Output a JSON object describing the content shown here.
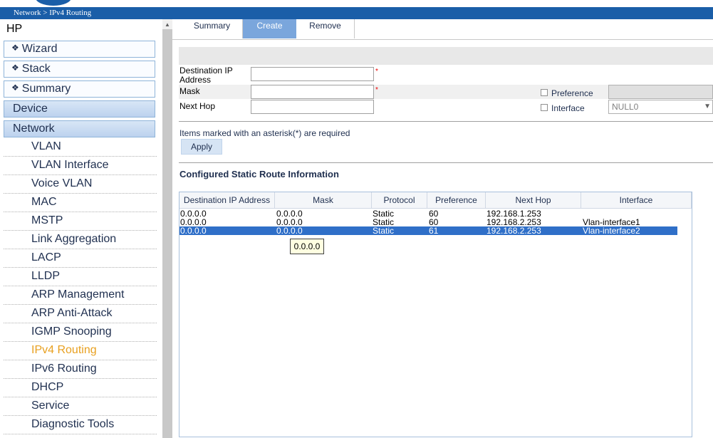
{
  "breadcrumb": "Network > IPv4 Routing",
  "sidebar": {
    "root": "HP",
    "boxes": [
      "Wizard",
      "Stack",
      "Summary"
    ],
    "categories": [
      "Device",
      "Network"
    ],
    "items": [
      "VLAN",
      "VLAN Interface",
      "Voice VLAN",
      "MAC",
      "MSTP",
      "Link Aggregation",
      "LACP",
      "LLDP",
      "ARP Management",
      "ARP Anti-Attack",
      "IGMP Snooping",
      "IPv4 Routing",
      "IPv6 Routing",
      "DHCP",
      "Service",
      "Diagnostic Tools"
    ],
    "active_item": "IPv4 Routing"
  },
  "tabs": [
    "Summary",
    "Create",
    "Remove"
  ],
  "active_tab": "Create",
  "form": {
    "dest_label": "Destination IP Address",
    "mask_label": "Mask",
    "nexthop_label": "Next Hop",
    "dest_value": "",
    "mask_value": "",
    "nexthop_value": "",
    "asterisk": "*",
    "preference_label": "Preference",
    "interface_label": "Interface",
    "interface_value": "NULL0",
    "note": "Items marked with an asterisk(*) are required",
    "apply_label": "Apply"
  },
  "routes": {
    "title": "Configured Static Route Information",
    "columns": [
      "Destination IP Address",
      "Mask",
      "Protocol",
      "Preference",
      "Next Hop",
      "Interface"
    ],
    "rows": [
      [
        "0.0.0.0",
        "0.0.0.0",
        "Static",
        "60",
        "192.168.1.253",
        ""
      ],
      [
        "0.0.0.0",
        "0.0.0.0",
        "Static",
        "60",
        "192.168.2.253",
        "Vlan-interface1"
      ],
      [
        "0.0.0.0",
        "0.0.0.0",
        "Static",
        "61",
        "192.168.2.253",
        "Vlan-interface2"
      ]
    ],
    "selected_row": 3,
    "tooltip": "0.0.0.0"
  },
  "colors": {
    "header_blue": "#1a5ea8",
    "selection_blue": "#2f6fc8",
    "active_orange": "#e8a020"
  }
}
